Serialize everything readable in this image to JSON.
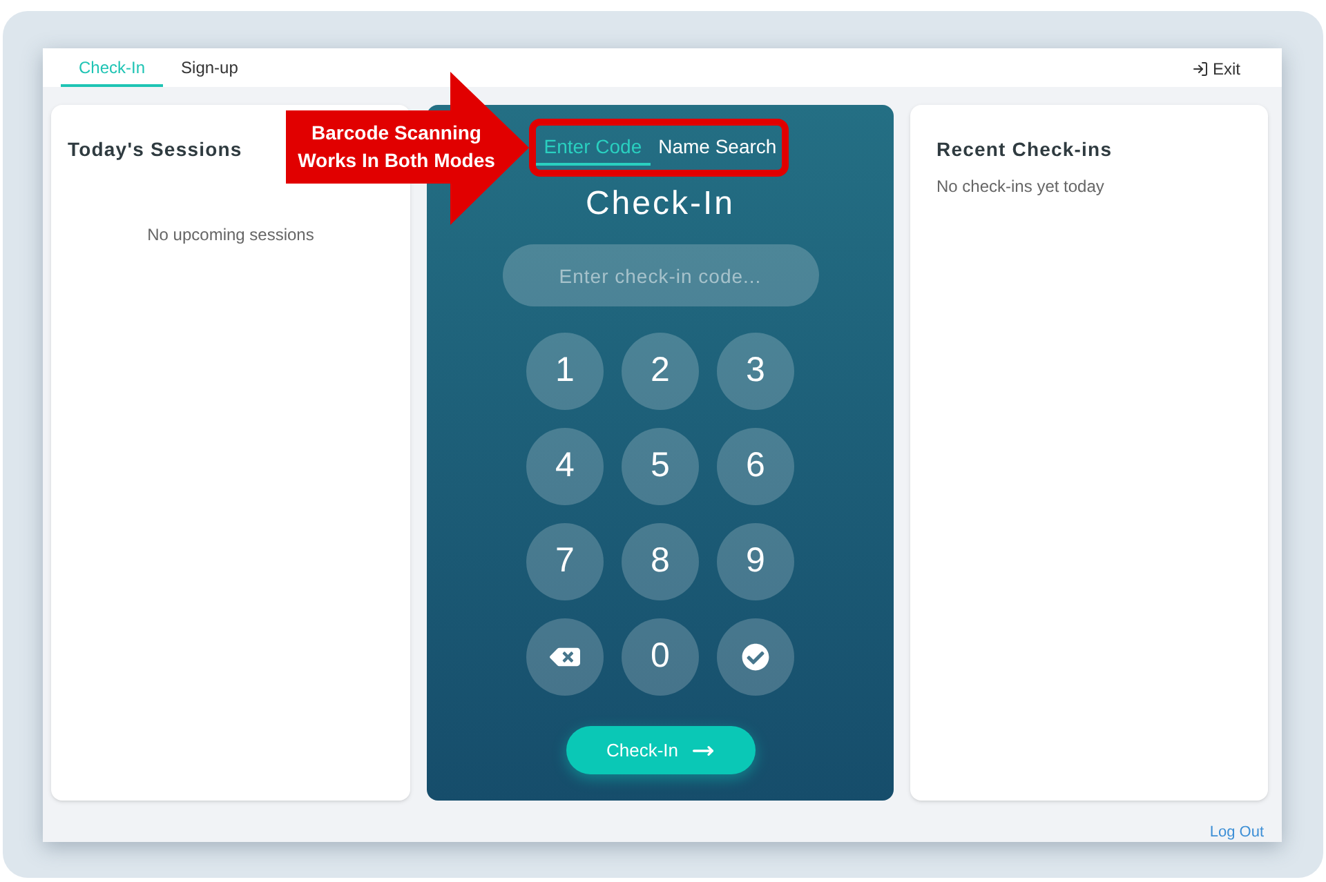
{
  "nav": {
    "tabs": [
      {
        "label": "Check-In",
        "selected": true
      },
      {
        "label": "Sign-up",
        "selected": false
      }
    ],
    "exit": {
      "label": "Exit"
    }
  },
  "sessions_panel": {
    "title": "Today's Sessions",
    "empty_message": "No upcoming sessions"
  },
  "checkin_panel": {
    "mode_tabs": [
      {
        "label": "Enter Code",
        "selected": true
      },
      {
        "label": "Name Search",
        "selected": false
      }
    ],
    "title": "Check-In",
    "code_field": {
      "placeholder": "Enter check-in code..."
    },
    "keypad": [
      {
        "kind": "digit",
        "label": "1"
      },
      {
        "kind": "digit",
        "label": "2"
      },
      {
        "kind": "digit",
        "label": "3"
      },
      {
        "kind": "digit",
        "label": "4"
      },
      {
        "kind": "digit",
        "label": "5"
      },
      {
        "kind": "digit",
        "label": "6"
      },
      {
        "kind": "digit",
        "label": "7"
      },
      {
        "kind": "digit",
        "label": "8"
      },
      {
        "kind": "digit",
        "label": "9"
      },
      {
        "kind": "backspace"
      },
      {
        "kind": "digit",
        "label": "0"
      },
      {
        "kind": "confirm"
      }
    ],
    "submit_button": {
      "label": "Check-In"
    }
  },
  "recent_panel": {
    "title": "Recent Check-ins",
    "empty_message": "No check-ins yet today"
  },
  "footer": {
    "logout": {
      "label": "Log Out"
    }
  },
  "annotation": {
    "callout": "Barcode Scanning Works In Both Modes"
  }
}
